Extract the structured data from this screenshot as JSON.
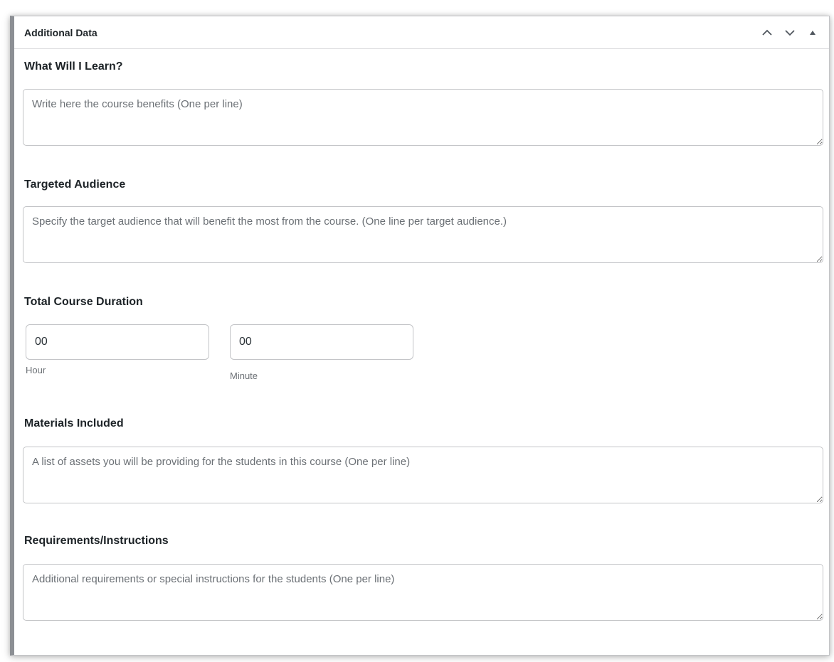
{
  "panel": {
    "title": "Additional Data",
    "controls": {
      "move_up_icon": "chevron-up-icon",
      "move_down_icon": "chevron-down-icon",
      "toggle_icon": "caret-up-icon"
    }
  },
  "fields": {
    "what_will_i_learn": {
      "label": "What Will I Learn?",
      "placeholder": "Write here the course benefits (One per line)",
      "value": ""
    },
    "targeted_audience": {
      "label": "Targeted Audience",
      "placeholder": "Specify the target audience that will benefit the most from the course. (One line per target audience.)",
      "value": ""
    },
    "total_course_duration": {
      "label": "Total Course Duration",
      "hour": {
        "value": "00",
        "label": "Hour"
      },
      "minute": {
        "value": "00",
        "label": "Minute"
      }
    },
    "materials_included": {
      "label": "Materials Included",
      "placeholder": "A list of assets you will be providing for the students in this course (One per line)",
      "value": ""
    },
    "requirements_instructions": {
      "label": "Requirements/Instructions",
      "placeholder": "Additional requirements or special instructions for the students (One per line)",
      "value": ""
    }
  },
  "colors": {
    "border": "#c3c4c7",
    "text": "#1d2327",
    "placeholder": "#6b7075"
  }
}
